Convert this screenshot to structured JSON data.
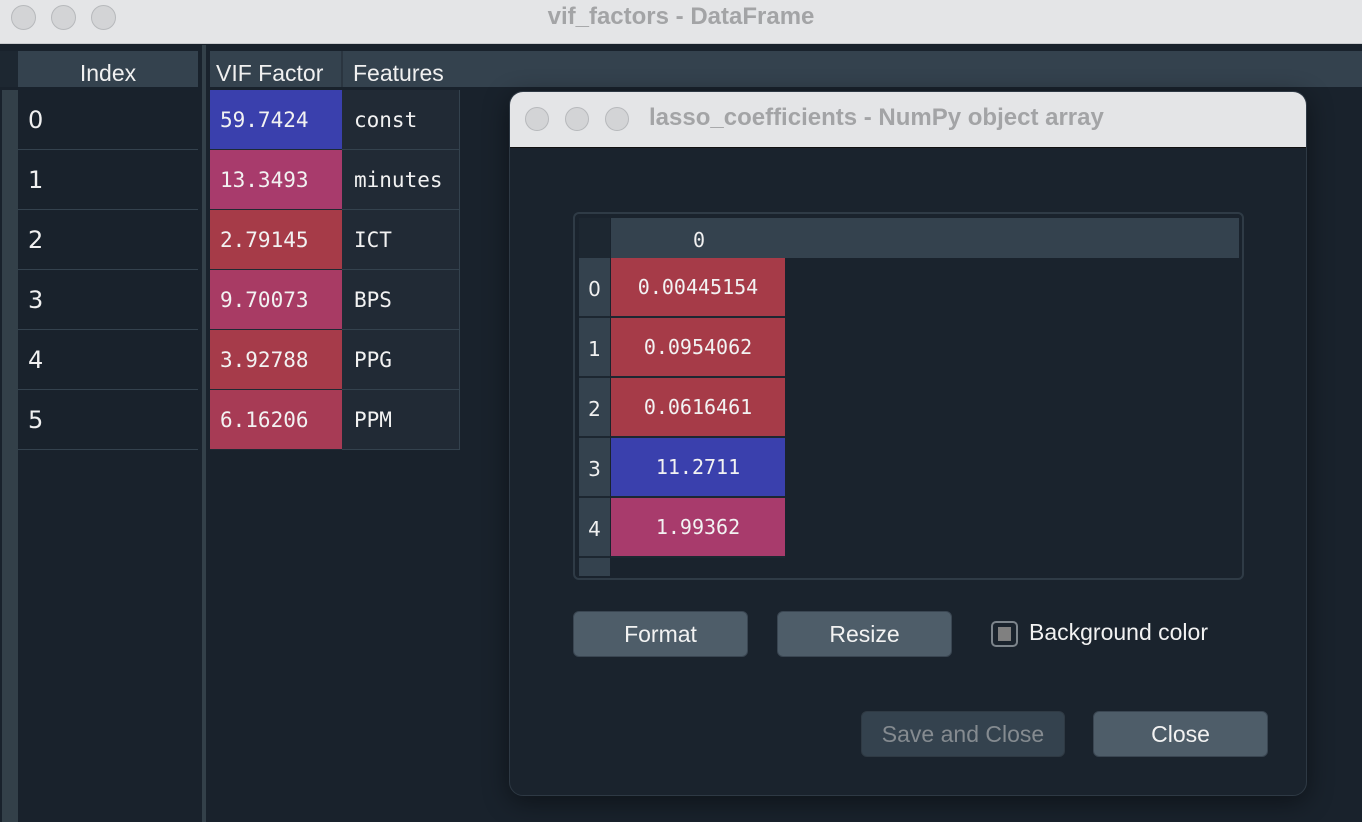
{
  "main_window": {
    "title": "vif_factors - DataFrame",
    "index_header": "Index",
    "columns": [
      "VIF Factor",
      "Features"
    ],
    "rows": [
      {
        "index": "0",
        "vif": "59.7424",
        "feature": "const",
        "color": "#3a40ad"
      },
      {
        "index": "1",
        "vif": "13.3493",
        "feature": "minutes",
        "color": "#a83b6c"
      },
      {
        "index": "2",
        "vif": "2.79145",
        "feature": "ICT",
        "color": "#a63b48"
      },
      {
        "index": "3",
        "vif": "9.70073",
        "feature": "BPS",
        "color": "#a83b64"
      },
      {
        "index": "4",
        "vif": "3.92788",
        "feature": "PPG",
        "color": "#a63b4a"
      },
      {
        "index": "5",
        "vif": "6.16206",
        "feature": "PPM",
        "color": "#a73b55"
      }
    ]
  },
  "dialog": {
    "title": "lasso_coefficients - NumPy object array",
    "column_header": "0",
    "rows": [
      {
        "index": "0",
        "value": "0.00445154",
        "color": "#a63b48"
      },
      {
        "index": "1",
        "value": "0.0954062",
        "color": "#a63b48"
      },
      {
        "index": "2",
        "value": "0.0616461",
        "color": "#a63b48"
      },
      {
        "index": "3",
        "value": "11.2711",
        "color": "#3a40ad"
      },
      {
        "index": "4",
        "value": "1.99362",
        "color": "#a83b6c"
      }
    ],
    "buttons": {
      "format": "Format",
      "resize": "Resize",
      "save_and_close": "Save and Close",
      "close": "Close"
    },
    "background_color": {
      "label": "Background color",
      "checked": "partial"
    }
  }
}
